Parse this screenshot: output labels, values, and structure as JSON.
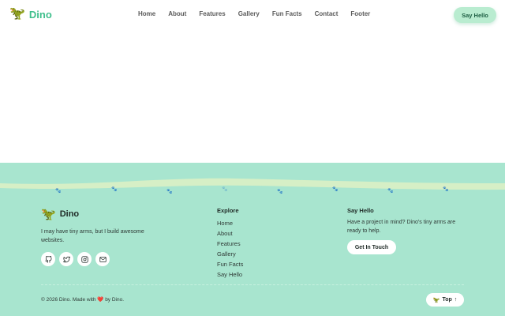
{
  "header": {
    "brand_logo": "🦖",
    "brand_name": "Dino",
    "nav": [
      "Home",
      "About",
      "Features",
      "Gallery",
      "Fun Facts",
      "Contact",
      "Footer"
    ],
    "cta_label": "Say Hello"
  },
  "footer": {
    "brand_logo": "🦖",
    "brand_name": "Dino",
    "tagline": "I may have tiny arms, but I build awesome websites.",
    "socials": [
      "github-icon",
      "twitter-icon",
      "instagram-icon",
      "mail-icon"
    ],
    "explore": {
      "title": "Explore",
      "links": [
        "Home",
        "About",
        "Features",
        "Gallery",
        "Fun Facts",
        "Say Hello"
      ]
    },
    "say_hello": {
      "title": "Say Hello",
      "text": "Have a project in mind? Dino's tiny arms are ready to help.",
      "button_label": "Get In Touch"
    },
    "copyright_prefix": "© 2026 Dino. Made with",
    "heart": "❤️",
    "copyright_suffix": "by Dino.",
    "top_logo": "🦖",
    "top_label": "Top",
    "top_arrow": "↑"
  },
  "colors": {
    "accent": "#3fbf8c",
    "footer_bg": "#a8e5cf",
    "cta_bg": "#b9ecd0"
  }
}
